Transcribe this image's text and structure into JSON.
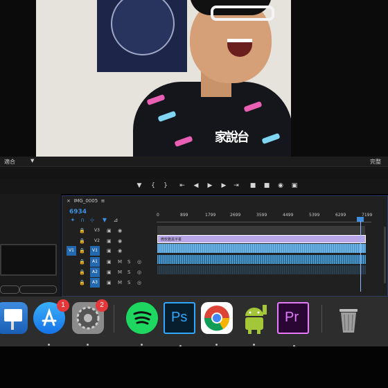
{
  "monitor": {
    "fit_label": "適合",
    "full_label": "完整"
  },
  "video": {
    "shirt_text": "家說台"
  },
  "transport": {
    "buttons": [
      "marker-icon",
      "mark-in-icon",
      "mark-out-icon",
      "go-to-in-icon",
      "step-back-icon",
      "play-icon",
      "step-forward-icon",
      "go-to-out-icon",
      "lift-icon",
      "extract-icon",
      "export-frame-icon",
      "compare-icon"
    ]
  },
  "timeline": {
    "tab_label": "IMG_0005",
    "timecode": "6934",
    "ruler_ticks": [
      "0",
      "899",
      "1799",
      "2699",
      "3599",
      "4499",
      "5399",
      "6299",
      "7199"
    ],
    "tracks": [
      {
        "name": "V3",
        "type": "video"
      },
      {
        "name": "V2",
        "type": "video"
      },
      {
        "name": "V1",
        "type": "video",
        "source": "V1",
        "selected": true
      },
      {
        "name": "A1",
        "type": "audio",
        "selected": true
      },
      {
        "name": "A2",
        "type": "audio",
        "selected": true
      },
      {
        "name": "A3",
        "type": "audio",
        "selected": true
      }
    ],
    "audio_flags": {
      "m": "M",
      "s": "S"
    },
    "subtitle_clip_label": "微软雅黑字幕"
  },
  "dock": {
    "apps": [
      {
        "name": "Keynote",
        "icon": "keynote-icon"
      },
      {
        "name": "App Store",
        "icon": "app-store-icon",
        "badge": "1"
      },
      {
        "name": "System Preferences",
        "icon": "system-preferences-icon",
        "badge": "2"
      },
      {
        "name": "Spotify",
        "icon": "spotify-icon"
      },
      {
        "name": "Photoshop",
        "icon": "photoshop-icon",
        "label": "Ps"
      },
      {
        "name": "Chrome",
        "icon": "chrome-icon"
      },
      {
        "name": "Android File Transfer",
        "icon": "android-icon"
      },
      {
        "name": "Premiere Pro",
        "icon": "premiere-icon",
        "label": "Pr"
      },
      {
        "name": "Trash",
        "icon": "trash-icon"
      }
    ]
  },
  "colors": {
    "accent_blue": "#3f8fe0",
    "track_select": "#2469b0",
    "purple_clip": "#b9a7e8",
    "badge_red": "#e5383b"
  }
}
